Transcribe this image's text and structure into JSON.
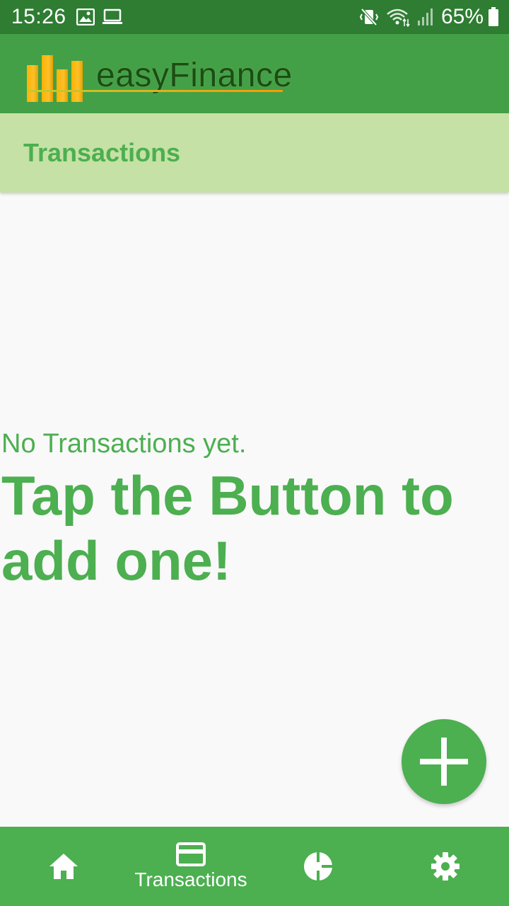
{
  "status_bar": {
    "time": "15:26",
    "battery": "65%",
    "icons": [
      "image-icon",
      "laptop-icon",
      "vibrate-mute-icon",
      "wifi-icon",
      "signal-icon",
      "battery-icon"
    ]
  },
  "app_bar": {
    "logo_text": "easyFinance"
  },
  "section": {
    "title": "Transactions"
  },
  "empty_state": {
    "line1": "No Transactions yet.",
    "line2": "Tap the Button to add one!"
  },
  "fab": {
    "icon": "plus-icon"
  },
  "bottom_nav": {
    "items": [
      {
        "icon": "home-icon",
        "label": ""
      },
      {
        "icon": "credit-card-icon",
        "label": "Transactions",
        "selected": true
      },
      {
        "icon": "pie-chart-icon",
        "label": ""
      },
      {
        "icon": "gear-icon",
        "label": ""
      }
    ]
  },
  "colors": {
    "status_bar": "#2e7d32",
    "app_bar": "#43a047",
    "section_header": "#c5e1a5",
    "accent": "#4caf50",
    "background": "#f9f9f9"
  }
}
